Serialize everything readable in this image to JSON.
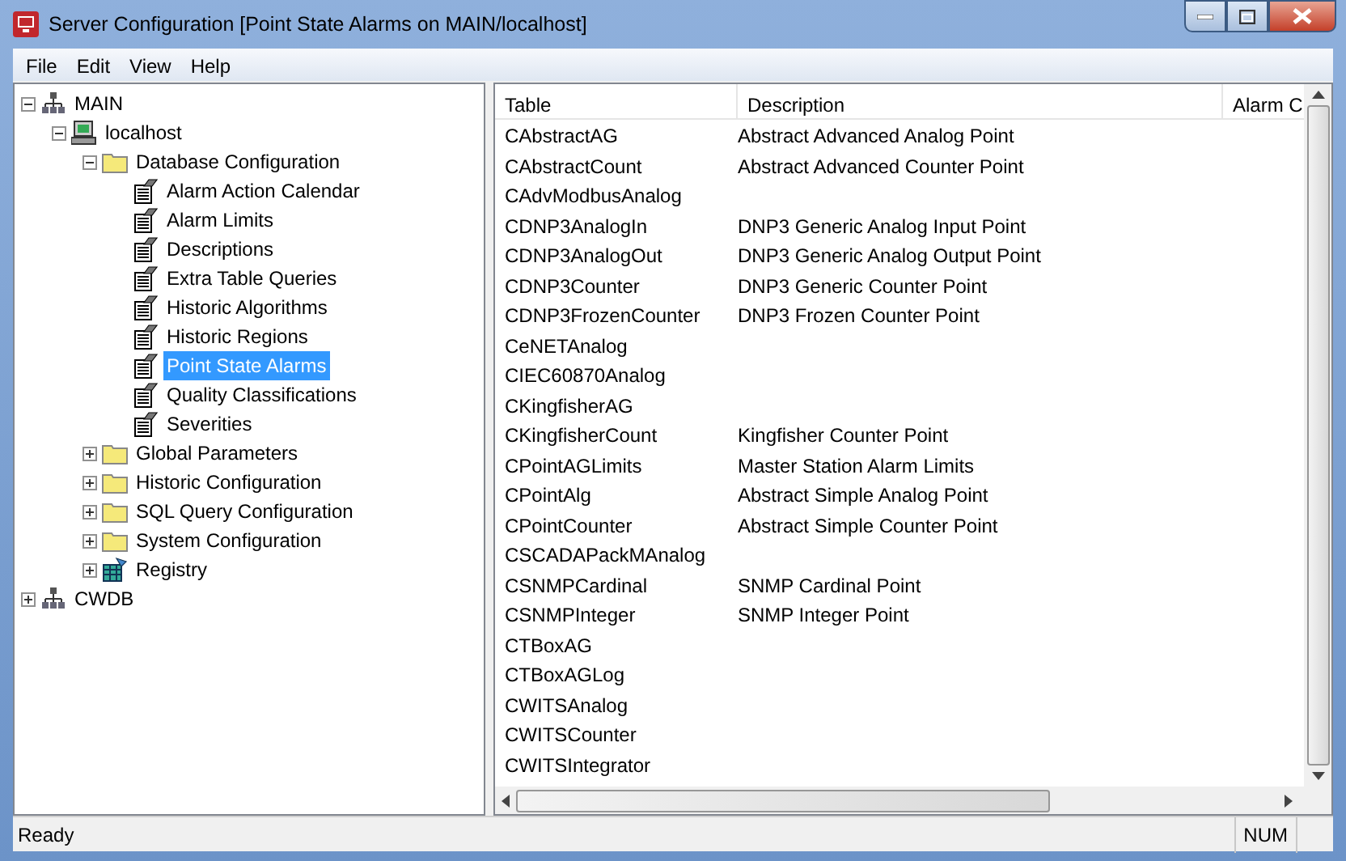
{
  "window": {
    "title": "Server Configuration [Point State Alarms on MAIN/localhost]"
  },
  "menu": [
    "File",
    "Edit",
    "View",
    "Help"
  ],
  "tree": [
    {
      "label": "MAIN",
      "kind": "server",
      "expanded": true,
      "selected": false,
      "children": [
        {
          "label": "localhost",
          "kind": "computer",
          "expanded": true,
          "selected": false,
          "children": [
            {
              "label": "Database Configuration",
              "kind": "folder",
              "expanded": true,
              "selected": false,
              "children": [
                {
                  "label": "Alarm Action Calendar",
                  "kind": "table",
                  "selected": false
                },
                {
                  "label": "Alarm Limits",
                  "kind": "table",
                  "selected": false
                },
                {
                  "label": "Descriptions",
                  "kind": "table",
                  "selected": false
                },
                {
                  "label": "Extra Table Queries",
                  "kind": "table",
                  "selected": false
                },
                {
                  "label": "Historic Algorithms",
                  "kind": "table",
                  "selected": false
                },
                {
                  "label": "Historic Regions",
                  "kind": "table",
                  "selected": false
                },
                {
                  "label": "Point State Alarms",
                  "kind": "table",
                  "selected": true
                },
                {
                  "label": "Quality Classifications",
                  "kind": "table",
                  "selected": false
                },
                {
                  "label": "Severities",
                  "kind": "table",
                  "selected": false
                }
              ]
            },
            {
              "label": "Global Parameters",
              "kind": "folder",
              "expanded": false,
              "selected": false
            },
            {
              "label": "Historic Configuration",
              "kind": "folder",
              "expanded": false,
              "selected": false
            },
            {
              "label": "SQL Query Configuration",
              "kind": "folder",
              "expanded": false,
              "selected": false
            },
            {
              "label": "System Configuration",
              "kind": "folder",
              "expanded": false,
              "selected": false
            },
            {
              "label": "Registry",
              "kind": "registry",
              "expanded": false,
              "selected": false
            }
          ]
        }
      ]
    },
    {
      "label": "CWDB",
      "kind": "server",
      "expanded": false,
      "selected": false
    }
  ],
  "table": {
    "columns": [
      "Table",
      "Description",
      "Alarm C"
    ],
    "rows": [
      [
        "CAbstractAG",
        "Abstract Advanced Analog Point"
      ],
      [
        "CAbstractCount",
        "Abstract Advanced Counter Point"
      ],
      [
        "CAdvModbusAnalog",
        ""
      ],
      [
        "CDNP3AnalogIn",
        "DNP3 Generic Analog Input Point"
      ],
      [
        "CDNP3AnalogOut",
        "DNP3 Generic Analog Output Point"
      ],
      [
        "CDNP3Counter",
        "DNP3 Generic Counter Point"
      ],
      [
        "CDNP3FrozenCounter",
        "DNP3 Frozen Counter Point"
      ],
      [
        "CeNETAnalog",
        ""
      ],
      [
        "CIEC60870Analog",
        ""
      ],
      [
        "CKingfisherAG",
        ""
      ],
      [
        "CKingfisherCount",
        "Kingfisher Counter Point"
      ],
      [
        "CPointAGLimits",
        "Master Station Alarm Limits"
      ],
      [
        "CPointAlg",
        "Abstract Simple Analog Point"
      ],
      [
        "CPointCounter",
        "Abstract Simple Counter Point"
      ],
      [
        "CSCADAPackMAnalog",
        ""
      ],
      [
        "CSNMPCardinal",
        "SNMP Cardinal Point"
      ],
      [
        "CSNMPInteger",
        "SNMP Integer Point"
      ],
      [
        "CTBoxAG",
        ""
      ],
      [
        "CTBoxAGLog",
        ""
      ],
      [
        "CWITSAnalog",
        ""
      ],
      [
        "CWITSCounter",
        ""
      ],
      [
        "CWITSIntegrator",
        ""
      ]
    ]
  },
  "status_bar": {
    "text": "Ready",
    "indicator": "NUM"
  }
}
